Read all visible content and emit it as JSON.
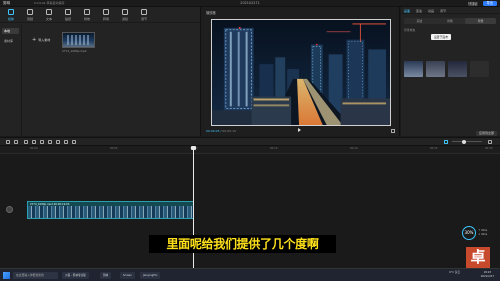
{
  "topbar": {
    "app_name": "剪映",
    "autosave": "0:24:44 草稿自动保存",
    "project_title": "202102271",
    "shortcut": "快捷键",
    "export": "导出"
  },
  "media_tools": [
    {
      "label": "媒体"
    },
    {
      "label": "音频"
    },
    {
      "label": "文本"
    },
    {
      "label": "贴纸"
    },
    {
      "label": "特效"
    },
    {
      "label": "转场"
    },
    {
      "label": "滤镜"
    },
    {
      "label": "调节"
    }
  ],
  "media_sidebar": [
    "本地",
    "素材库"
  ],
  "media": {
    "import_label": "导入素材",
    "clip_name": "2774_1080p.mp4"
  },
  "player": {
    "title": "播放器",
    "timecode": "00:00:05",
    "duration": "00:00:19"
  },
  "right_panel": {
    "tabs": [
      "画面",
      "变速",
      "动画",
      "调节"
    ],
    "subtabs": [
      "基础",
      "抠像",
      "背景"
    ],
    "section_label": "背景填充",
    "tooltip": "设置于画布",
    "apply_all": "应用到全部"
  },
  "timeline": {
    "ruler_ticks": [
      "00:00",
      "00:05",
      "00:10",
      "00:15",
      "00:20",
      "00:25",
      "00:30"
    ],
    "clip_label": "2774_1080p.mp4 00:00:19:03"
  },
  "subtitle": "里面呢给我们提供了几个度啊",
  "speed_badge": {
    "percent": "30%",
    "up": "↑ 0K/s",
    "down": "↓ 0K/s"
  },
  "logo_char": "卓",
  "taskbar": {
    "search": "在这里输入你要搜索的",
    "apps": [
      "沙霸 - 剪映专业版",
      "剪映",
      "Screen",
      "JianyingPro"
    ],
    "weather": "6°C 多云",
    "time": "18:23",
    "date": "2021/2/27"
  },
  "colors": {
    "accent": "#3ec7ff",
    "subtitle_text": "#ffe11a",
    "subtitle_bg": "#000000",
    "clip_border": "#2b9fb0"
  }
}
